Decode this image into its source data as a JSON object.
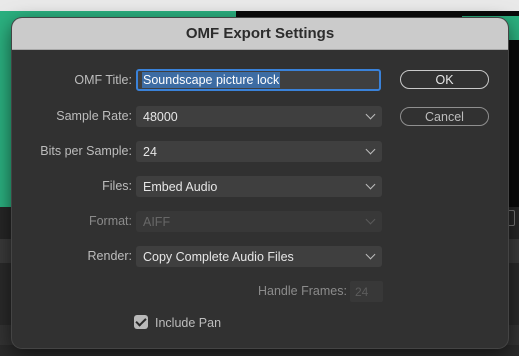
{
  "dialog": {
    "title": "OMF Export Settings",
    "fields": {
      "omf_title": {
        "label": "OMF Title:",
        "value": "Soundscape picture lock"
      },
      "sample_rate": {
        "label": "Sample Rate:",
        "value": "48000"
      },
      "bits_per_sample": {
        "label": "Bits per Sample:",
        "value": "24"
      },
      "files": {
        "label": "Files:",
        "value": "Embed Audio"
      },
      "format": {
        "label": "Format:",
        "value": "AIFF"
      },
      "render": {
        "label": "Render:",
        "value": "Copy Complete Audio Files"
      },
      "handle_frames": {
        "label": "Handle Frames:",
        "value": "24"
      }
    },
    "include_pan": {
      "label": "Include Pan",
      "checked": true
    },
    "buttons": {
      "ok": "OK",
      "cancel": "Cancel"
    }
  },
  "colors": {
    "focus_ring": "#3a82d9",
    "selection": "#3d6ca3",
    "titlebar": "#cbcbcb",
    "dialog_bg": "#313131",
    "background_green": "#2bb07f"
  },
  "icons": [
    "chevron-down-icon",
    "checkmark-icon"
  ]
}
